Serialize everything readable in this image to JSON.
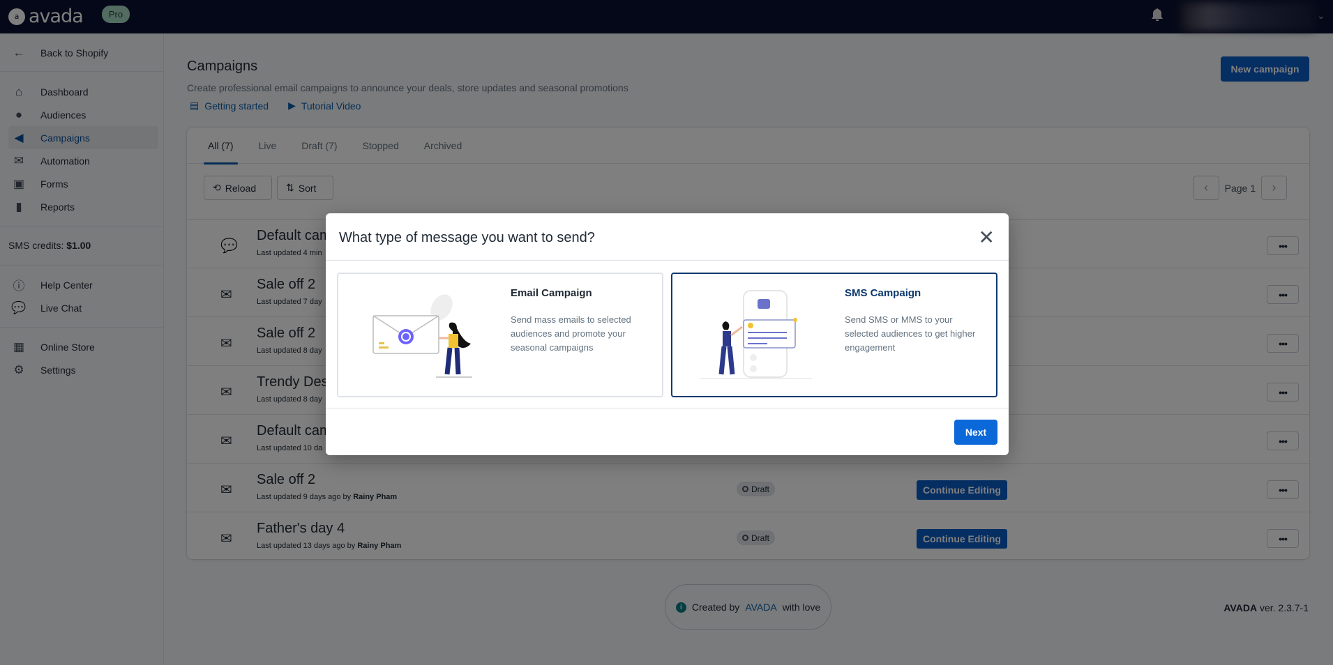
{
  "topbar": {
    "brand": "avada",
    "plan_badge": "Pro"
  },
  "sidebar": {
    "back": "Back to Shopify",
    "items": [
      {
        "label": "Dashboard",
        "icon": "home-icon"
      },
      {
        "label": "Audiences",
        "icon": "user-icon"
      },
      {
        "label": "Campaigns",
        "icon": "megaphone-icon",
        "active": true
      },
      {
        "label": "Automation",
        "icon": "mail-icon"
      },
      {
        "label": "Forms",
        "icon": "forms-icon"
      },
      {
        "label": "Reports",
        "icon": "bar-chart-icon"
      }
    ],
    "sms_label": "SMS credits:",
    "sms_value": "$1.00",
    "help": [
      {
        "label": "Help Center",
        "icon": "info-icon"
      },
      {
        "label": "Live Chat",
        "icon": "chat-icon"
      }
    ],
    "store": [
      {
        "label": "Online Store",
        "icon": "store-icon"
      },
      {
        "label": "Settings",
        "icon": "gear-icon"
      }
    ]
  },
  "page": {
    "title": "Campaigns",
    "subtitle": "Create professional email campaigns to announce your deals, store updates and seasonal promotions",
    "link_getting_started": "Getting started",
    "link_tutorial": "Tutorial Video",
    "new_campaign": "New campaign"
  },
  "tabs": [
    {
      "label": "All (7)",
      "active": true
    },
    {
      "label": "Live"
    },
    {
      "label": "Draft (7)"
    },
    {
      "label": "Stopped"
    },
    {
      "label": "Archived"
    }
  ],
  "toolbar": {
    "reload": "Reload",
    "sort": "Sort",
    "page": "Page 1"
  },
  "rows": [
    {
      "name": "Default cam",
      "meta": "Last updated 4 min",
      "by": "",
      "icon": "chat-icon"
    },
    {
      "name": "Sale off 2",
      "meta": "Last updated 7 day",
      "by": "",
      "icon": "mail-icon"
    },
    {
      "name": "Sale off 2",
      "meta": "Last updated 8 day",
      "by": "",
      "icon": "mail-icon"
    },
    {
      "name": "Trendy Des",
      "meta": "Last updated 8 day",
      "by": "",
      "icon": "mail-icon"
    },
    {
      "name": "Default cam",
      "meta": "Last updated 10 da",
      "by": "",
      "icon": "mail-icon"
    },
    {
      "name": "Sale off 2",
      "meta": "Last updated 9 days ago by ",
      "by": "Rainy Pham",
      "icon": "mail-icon",
      "status": "Draft",
      "action": "Continue Editing"
    },
    {
      "name": "Father's day 4",
      "meta": "Last updated 13 days ago by ",
      "by": "Rainy Pham",
      "icon": "mail-icon",
      "status": "Draft",
      "action": "Continue Editing"
    }
  ],
  "more_label": "•••",
  "footer": {
    "created_prefix": "Created by",
    "created_brand": "AVADA",
    "created_suffix": "with love",
    "version_brand": "AVADA",
    "version": "ver. 2.3.7-1"
  },
  "modal": {
    "title": "What type of message you want to send?",
    "close": "✕",
    "options": [
      {
        "title": "Email Campaign",
        "desc": "Send mass emails to selected audiences and promote your seasonal campaigns",
        "selected": false
      },
      {
        "title": "SMS Campaign",
        "desc": "Send SMS or MMS to your selected audiences to get higher engagement",
        "selected": true
      }
    ],
    "next": "Next"
  },
  "colors": {
    "topbar": "#0a1130",
    "primary": "#0b5cc7",
    "selected_border": "#0e3a6e"
  }
}
